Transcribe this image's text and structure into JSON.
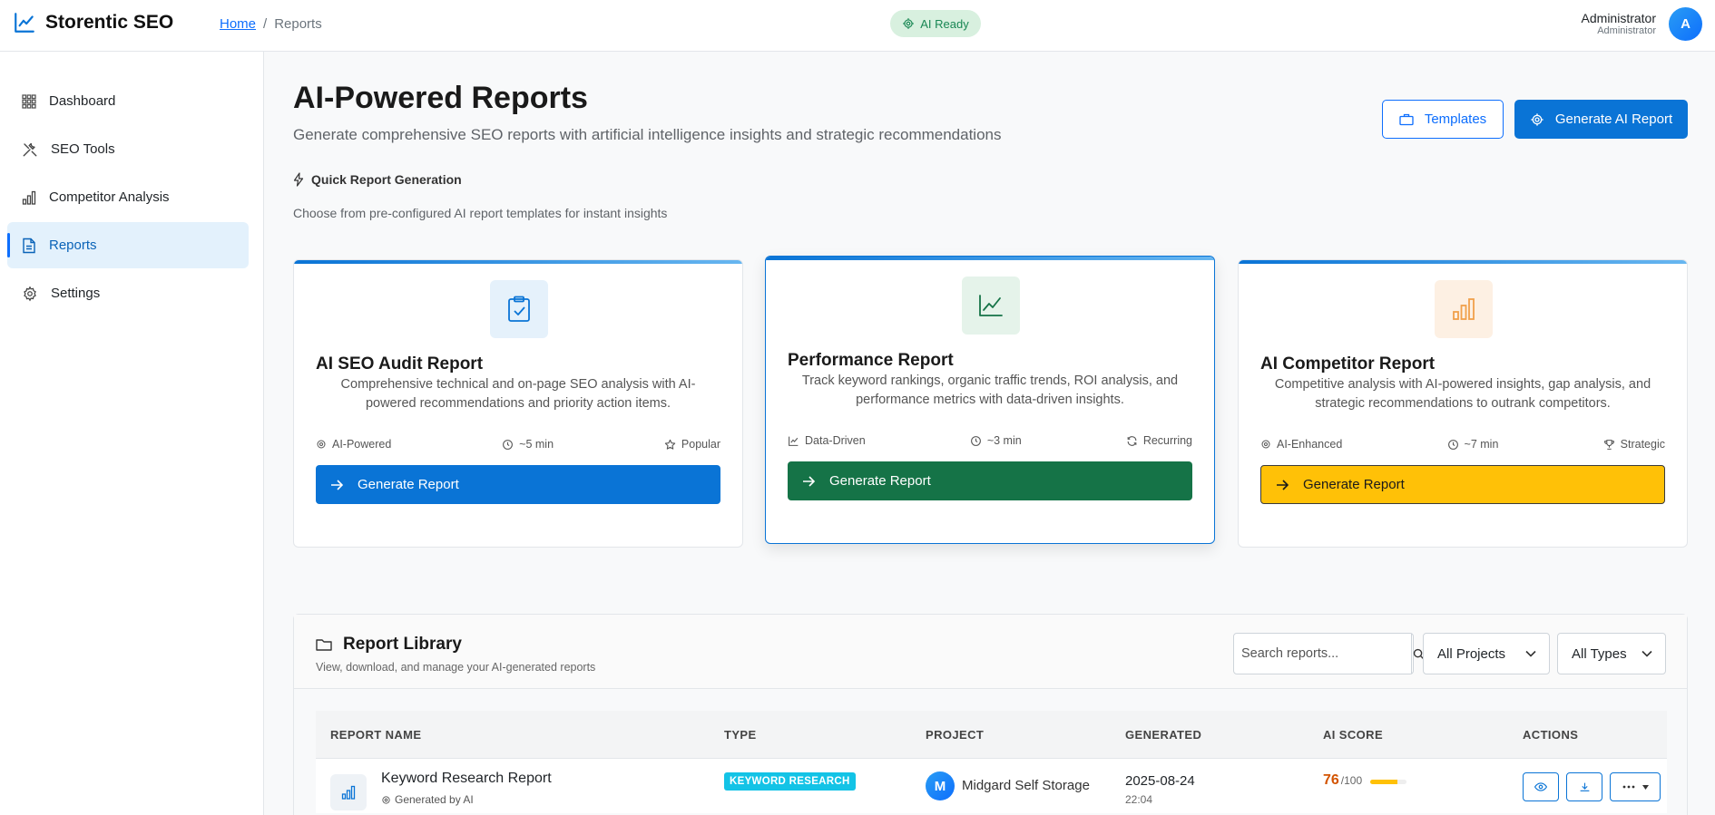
{
  "app": {
    "name": "Storentic SEO"
  },
  "breadcrumb": {
    "home": "Home",
    "separator": "/",
    "current": "Reports"
  },
  "status": {
    "ai_ready": "AI Ready"
  },
  "user": {
    "name": "Administrator",
    "role": "Administrator",
    "initial": "A"
  },
  "sidebar": {
    "items": [
      {
        "label": "Dashboard",
        "icon": "grid-icon"
      },
      {
        "label": "SEO Tools",
        "icon": "tools-icon"
      },
      {
        "label": "Competitor Analysis",
        "icon": "bar-chart-icon"
      },
      {
        "label": "Reports",
        "icon": "document-icon",
        "active": true
      },
      {
        "label": "Settings",
        "icon": "gear-icon"
      }
    ]
  },
  "header": {
    "title": "AI-Powered Reports",
    "subtitle": "Generate comprehensive SEO reports with artificial intelligence insights and strategic recommendations",
    "templates_label": "Templates",
    "generate_ai_label": "Generate AI Report"
  },
  "quick": {
    "title": "Quick Report Generation",
    "subtitle": "Choose from pre-configured AI report templates for instant insights"
  },
  "cards": [
    {
      "title": "AI SEO Audit Report",
      "description": "Comprehensive technical and on-page SEO analysis with AI-powered recommendations and priority action items.",
      "meta": [
        "AI-Powered",
        "~5 min",
        "Popular"
      ],
      "button": "Generate Report",
      "accent": "#0a74d6"
    },
    {
      "title": "Performance Report",
      "description": "Track keyword rankings, organic traffic trends, ROI analysis, and performance metrics with data-driven insights.",
      "meta": [
        "Data-Driven",
        "~3 min",
        "Recurring"
      ],
      "button": "Generate Report",
      "accent": "#157347"
    },
    {
      "title": "AI Competitor Report",
      "description": "Competitive analysis with AI-powered insights, gap analysis, and strategic recommendations to outrank competitors.",
      "meta": [
        "AI-Enhanced",
        "~7 min",
        "Strategic"
      ],
      "button": "Generate Report",
      "accent": "#ffc107"
    }
  ],
  "library": {
    "title": "Report Library",
    "subtitle": "View, download, and manage your AI-generated reports",
    "search_placeholder": "Search reports...",
    "filter_projects": "All Projects",
    "filter_types": "All Types",
    "columns": [
      "REPORT NAME",
      "TYPE",
      "PROJECT",
      "GENERATED",
      "AI SCORE",
      "ACTIONS"
    ],
    "rows": [
      {
        "name": "Keyword Research Report",
        "generated_by": "Generated by AI",
        "type": "KEYWORD RESEARCH",
        "project_initial": "M",
        "project": "Midgard Self Storage",
        "date": "2025-08-24",
        "time": "22:04",
        "score": "76",
        "score_max": "/100",
        "score_fraction": 0.76
      }
    ]
  }
}
